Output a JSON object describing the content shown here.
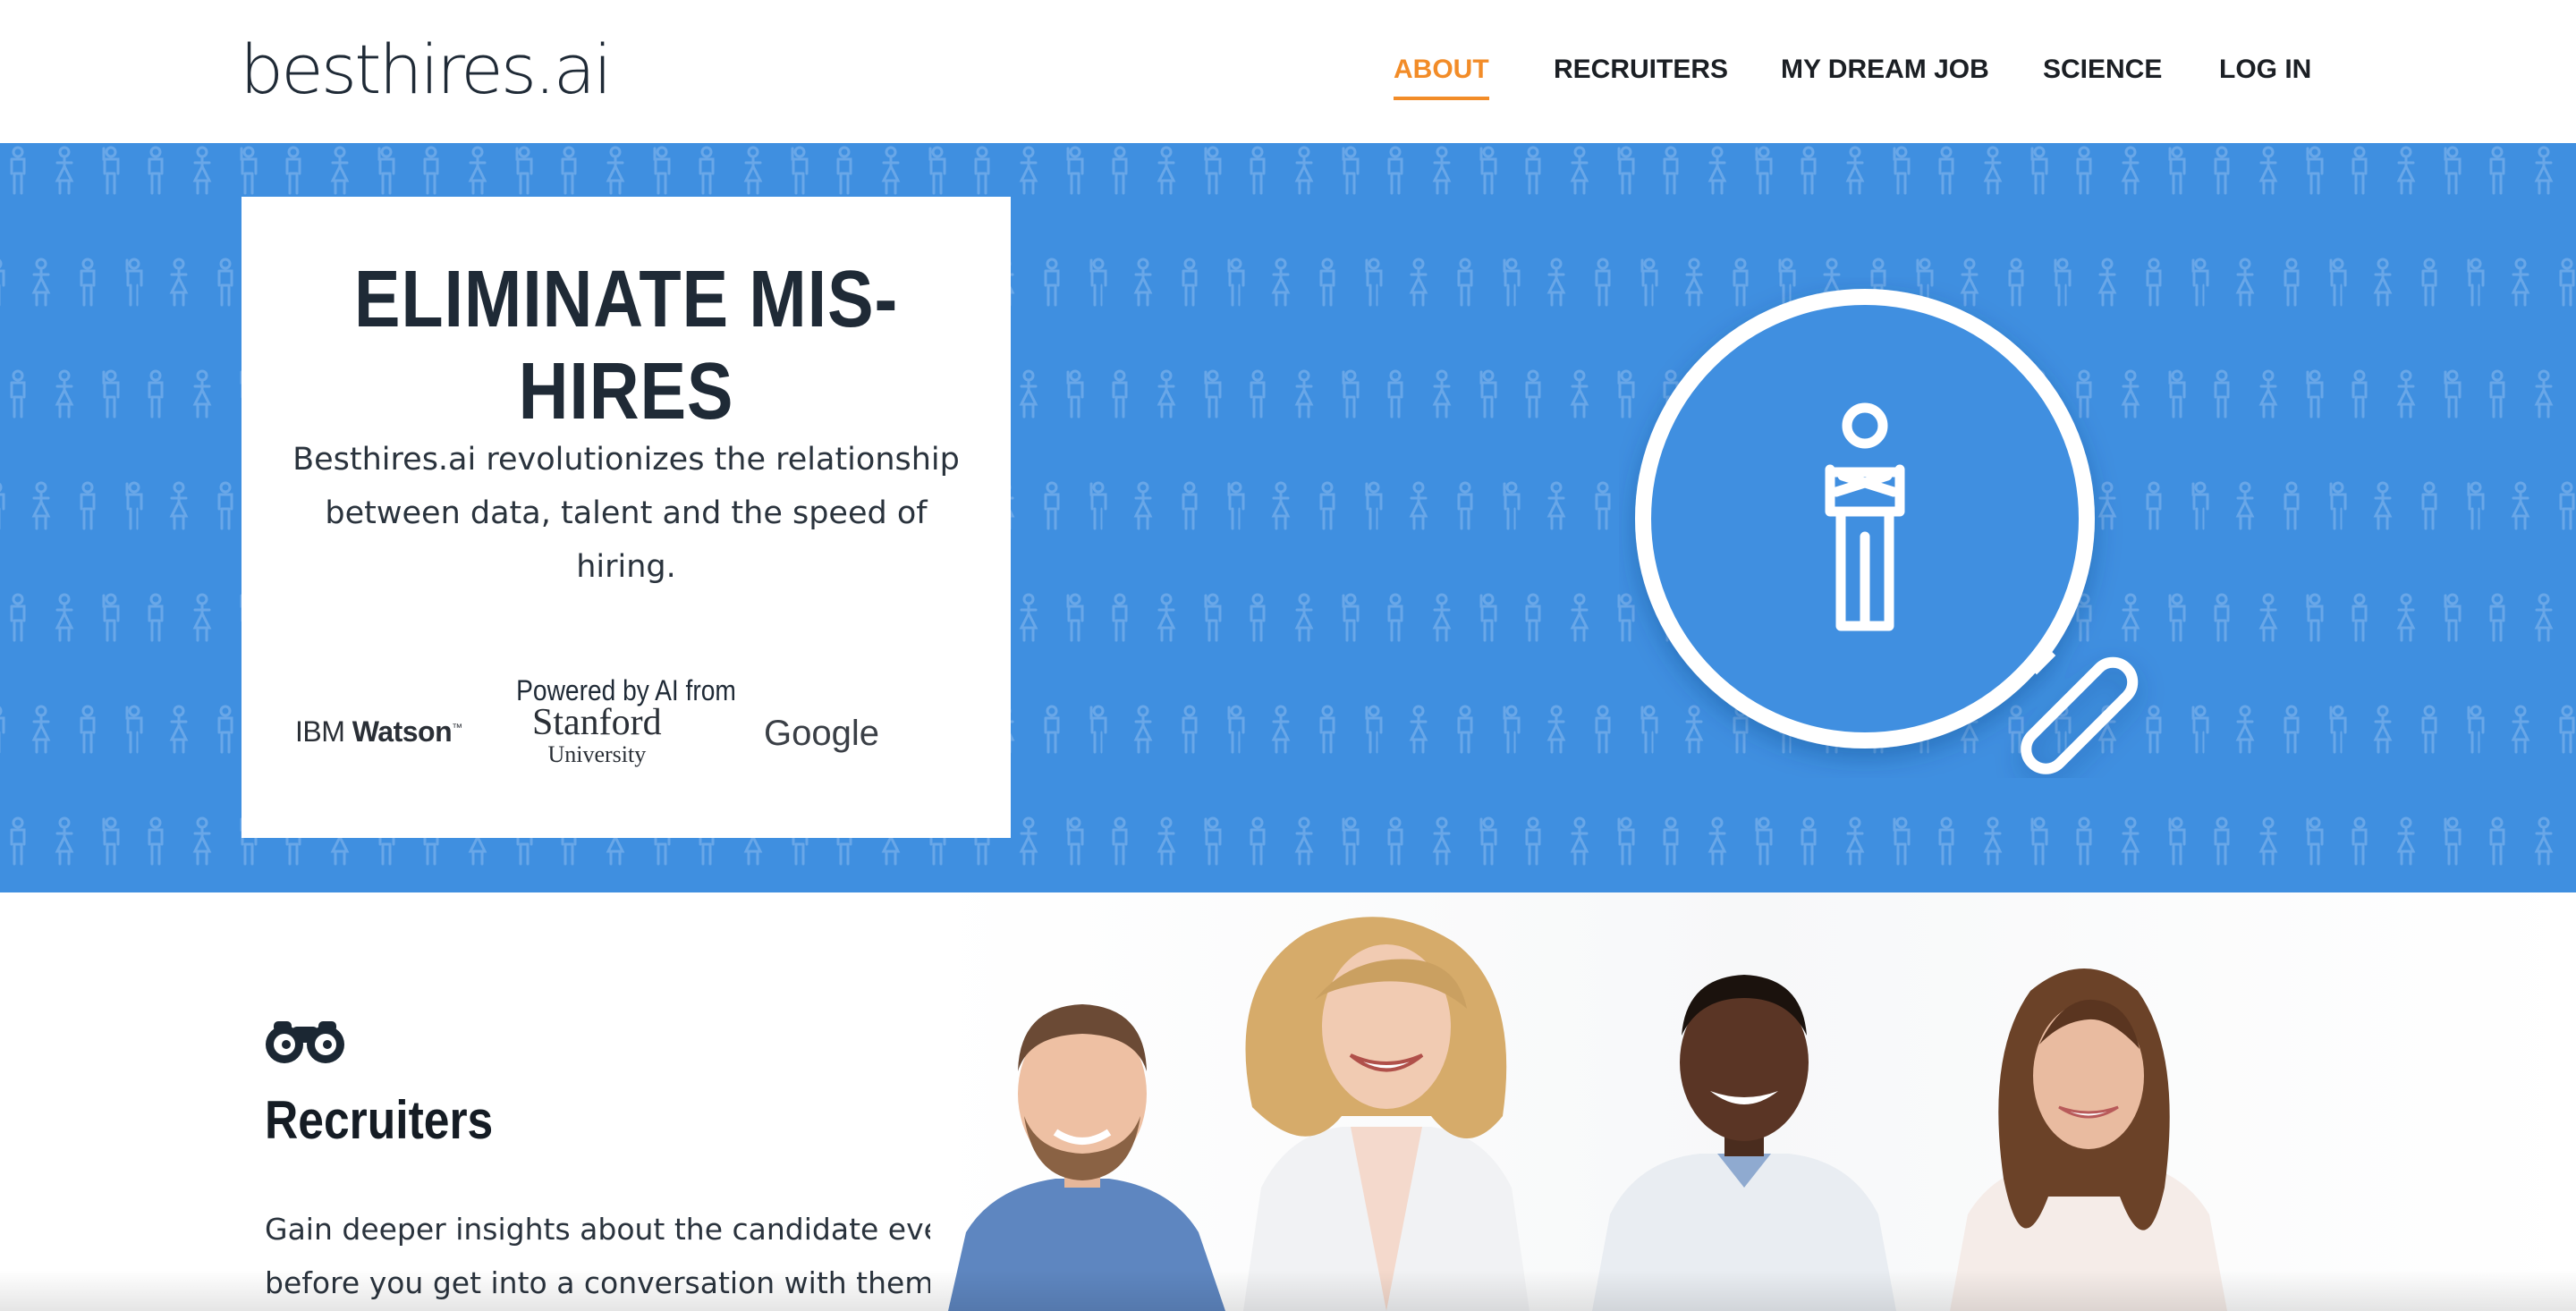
{
  "header": {
    "logo_text": "besthires.ai",
    "nav": [
      {
        "label": "ABOUT",
        "active": true
      },
      {
        "label": "RECRUITERS",
        "active": false
      },
      {
        "label": "MY DREAM JOB",
        "active": false
      },
      {
        "label": "SCIENCE",
        "active": false
      },
      {
        "label": "LOG IN",
        "active": false
      }
    ]
  },
  "hero": {
    "title": "ELIMINATE MIS-HIRES",
    "description_lines": [
      "Besthires.ai revolutionizes the relationship",
      "between data, talent and the speed of hiring."
    ],
    "powered_by": "Powered by AI from",
    "partners": {
      "ibm": {
        "light": "IBM",
        "bold": "Watson",
        "mark": "™"
      },
      "stanford": {
        "line1": "Stanford",
        "line2": "University"
      },
      "google": "Google"
    }
  },
  "recruiters": {
    "icon": "binoculars-icon",
    "title": "Recruiters",
    "text_lines": [
      "Gain deeper insights about the candidate even",
      "before you get into a conversation with them."
    ]
  },
  "colors": {
    "accent": "#f28c28",
    "hero_blue": "#3f8fe0",
    "text_dark": "#1f2a36"
  }
}
